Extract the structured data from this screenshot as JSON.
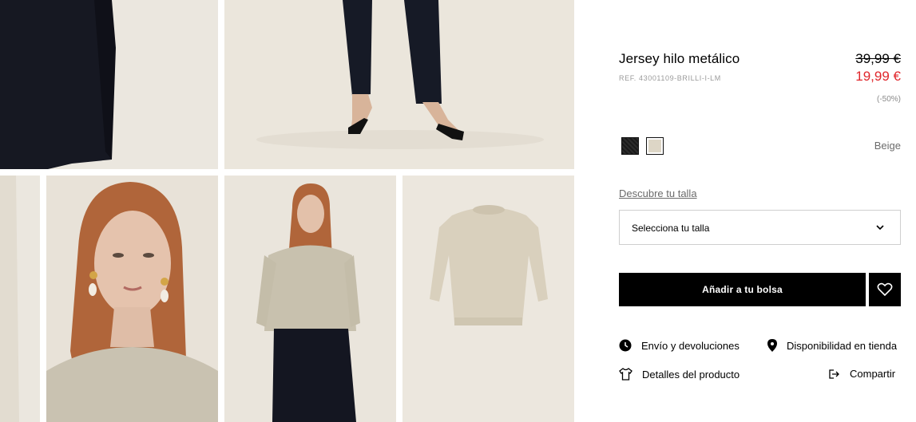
{
  "product": {
    "title": "Jersey hilo metálico",
    "ref": "REF. 43001109-BRILLI-I-LM",
    "old_price": "39,99 €",
    "new_price": "19,99 €",
    "discount": "(-50%)"
  },
  "colors": {
    "options": [
      "black-icon",
      "beige-icon"
    ],
    "selected_name": "Beige"
  },
  "size": {
    "guide_link": "Descubre tu talla",
    "select_label": "Selecciona tu talla"
  },
  "actions": {
    "add_to_bag": "Añadir a tu bolsa"
  },
  "links": {
    "shipping": "Envío y devoluciones",
    "store": "Disponibilidad en tienda",
    "details": "Detalles del producto",
    "share": "Compartir"
  },
  "colors_hex": {
    "sale": "#e0262b",
    "button": "#000000"
  }
}
